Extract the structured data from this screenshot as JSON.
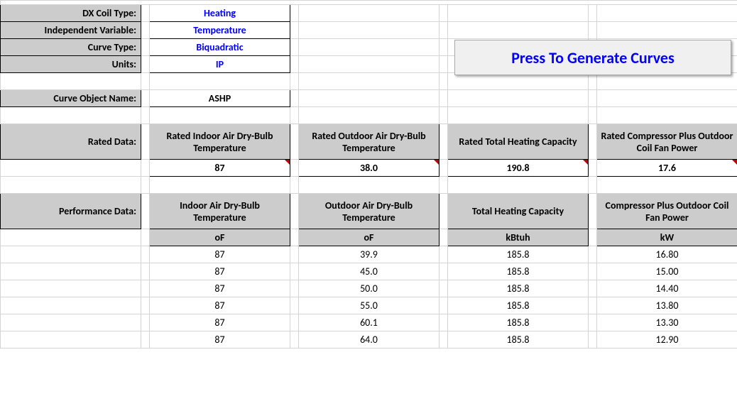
{
  "params": {
    "dx_coil_type_label": "DX Coil Type:",
    "dx_coil_type_value": "Heating",
    "indep_var_label": "Independent Variable:",
    "indep_var_value": "Temperature",
    "curve_type_label": "Curve Type:",
    "curve_type_value": "Biquadratic",
    "units_label": "Units:",
    "units_value": "IP",
    "curve_obj_label": "Curve Object Name:",
    "curve_obj_value": "ASHP"
  },
  "button": {
    "generate_label": "Press To Generate Curves"
  },
  "rated": {
    "section_label": "Rated Data:",
    "headers": {
      "indoor": "Rated Indoor Air Dry-Bulb Temperature",
      "outdoor": "Rated Outdoor Air Dry-Bulb Temperature",
      "capacity": "Rated Total Heating Capacity",
      "power": "Rated Compressor Plus Outdoor Coil Fan Power"
    },
    "values": {
      "indoor": "87",
      "outdoor": "38.0",
      "capacity": "190.8",
      "power": "17.6"
    }
  },
  "perf": {
    "section_label": "Performance Data:",
    "headers": {
      "indoor": "Indoor Air Dry-Bulb Temperature",
      "outdoor": "Outdoor Air Dry-Bulb Temperature",
      "capacity": "Total Heating Capacity",
      "power": "Compressor Plus Outdoor Coil Fan Power"
    },
    "units": {
      "indoor": "oF",
      "outdoor": "oF",
      "capacity": "kBtuh",
      "power": "kW"
    },
    "rows": [
      {
        "indoor": "87",
        "outdoor": "39.9",
        "capacity": "185.8",
        "power": "16.80"
      },
      {
        "indoor": "87",
        "outdoor": "45.0",
        "capacity": "185.8",
        "power": "15.00"
      },
      {
        "indoor": "87",
        "outdoor": "50.0",
        "capacity": "185.8",
        "power": "14.40"
      },
      {
        "indoor": "87",
        "outdoor": "55.0",
        "capacity": "185.8",
        "power": "13.80"
      },
      {
        "indoor": "87",
        "outdoor": "60.1",
        "capacity": "185.8",
        "power": "13.30"
      },
      {
        "indoor": "87",
        "outdoor": "64.0",
        "capacity": "185.8",
        "power": "12.90"
      }
    ]
  }
}
